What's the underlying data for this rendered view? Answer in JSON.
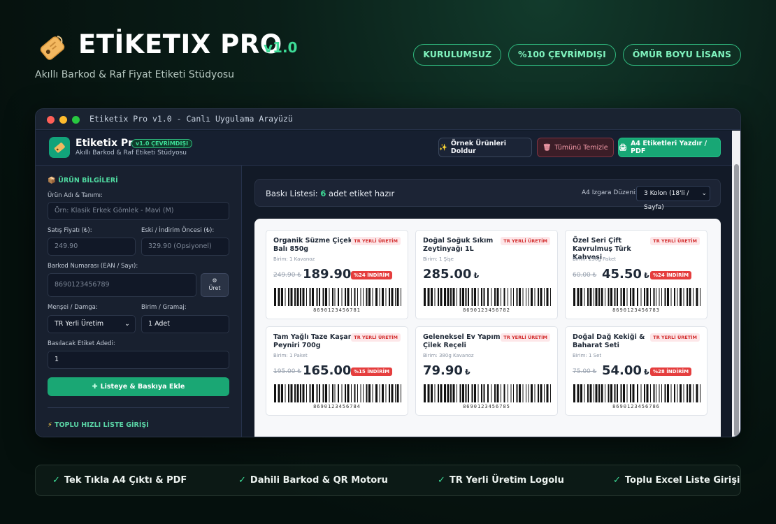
{
  "hero": {
    "title": "ETİKETIX PRO",
    "version": "v1.0",
    "subtitle": "Akıllı Barkod & Raf Fiyat Etiketi Stüdyosu",
    "pills": [
      "KURULUMSUZ",
      "%100 ÇEVRİMDIŞI",
      "ÖMÜR BOYU LİSANS"
    ]
  },
  "window": {
    "title": "Etiketix Pro v1.0 - Canlı Uygulama Arayüzü"
  },
  "app": {
    "name": "Etiketix Pro",
    "badge": "v1.0 ÇEVRİMDIŞI",
    "subtitle": "Akıllı Barkod & Raf Etiketi Stüdyosu",
    "demo_button": "Örnek Ürünleri Doldur",
    "clear_button": "Tümünü Temizle",
    "print_button": "A4 Etiketleri Yazdır / PDF"
  },
  "form": {
    "section_title": "ÜRÜN BİLGİLERİ",
    "name_label": "Ürün Adı & Tanımı:",
    "name_placeholder": "Örn: Klasik Erkek Gömlek - Mavi (M)",
    "price_label": "Satış Fiyatı (₺):",
    "price_placeholder": "249.90",
    "old_price_label": "Eski / İndirim Öncesi (₺):",
    "old_price_placeholder": "329.90 (Opsiyonel)",
    "barcode_label": "Barkod Numarası (EAN / Sayı):",
    "barcode_placeholder": "8690123456789",
    "generate_button": "Üret",
    "origin_label": "Menşei / Damga:",
    "origin_value": "TR Yerli Üretim",
    "unit_label": "Birim / Gramaj:",
    "unit_value": "1 Adet",
    "count_label": "Basılacak Etiket Adedi:",
    "count_value": "1",
    "add_button": "Listeye & Baskıya Ekle",
    "bulk_section_title": "TOPLU HIZLI LİSTE GİRİŞİ"
  },
  "print_list": {
    "title_prefix": "Baskı Listesi:",
    "count": "6",
    "title_suffix": "adet etiket hazır",
    "grid_label": "A4 Izgara Düzeni:",
    "grid_value": "3 Kolon (18'li / Sayfa)"
  },
  "labels": [
    {
      "name": "Organik Süzme Çiçek Balı 850g",
      "badge": "TR YERLİ ÜRETİM",
      "unit": "Birim: 1 Kavanoz",
      "old_price": "249.90 ₺",
      "price": "189.90",
      "currency": "₺",
      "discount": "%24 İNDİRİM",
      "barcode": "8690123456781"
    },
    {
      "name": "Doğal Soğuk Sıkım Zeytinyağı 1L",
      "badge": "TR YERLİ ÜRETİM",
      "unit": "Birim: 1 Şişe",
      "old_price": "",
      "price": "285.00",
      "currency": "₺",
      "discount": "",
      "barcode": "8690123456782"
    },
    {
      "name": "Özel Seri Çift Kavrulmuş Türk Kahvesi",
      "badge": "TR YERLİ ÜRETİM",
      "unit": "Birim: 250g Paket",
      "old_price": "60.00 ₺",
      "price": "45.50",
      "currency": "₺",
      "discount": "%24 İNDİRİM",
      "barcode": "8690123456783"
    },
    {
      "name": "Tam Yağlı Taze Kaşar Peyniri 700g",
      "badge": "TR YERLİ ÜRETİM",
      "unit": "Birim: 1 Paket",
      "old_price": "195.00 ₺",
      "price": "165.00",
      "currency": "₺",
      "discount": "%15 İNDİRİM",
      "barcode": "8690123456784"
    },
    {
      "name": "Geleneksel Ev Yapımı Çilek Reçeli",
      "badge": "TR YERLİ ÜRETİM",
      "unit": "Birim: 380g Kavanoz",
      "old_price": "",
      "price": "79.90",
      "currency": "₺",
      "discount": "",
      "barcode": "8690123456785"
    },
    {
      "name": "Doğal Dağ Kekiği & Baharat Seti",
      "badge": "TR YERLİ ÜRETİM",
      "unit": "Birim: 1 Set",
      "old_price": "75.00 ₺",
      "price": "54.00",
      "currency": "₺",
      "discount": "%28 İNDİRİM",
      "barcode": "8690123456786"
    }
  ],
  "features": [
    "Tek Tıkla A4 Çıktı & PDF",
    "Dahili Barkod & QR Motoru",
    "TR Yerli Üretim Logolu",
    "Toplu Excel Liste Girişi"
  ],
  "colors": {
    "accent": "#3ddc97",
    "primary_button": "#18a775",
    "danger": "#e53e3e"
  }
}
